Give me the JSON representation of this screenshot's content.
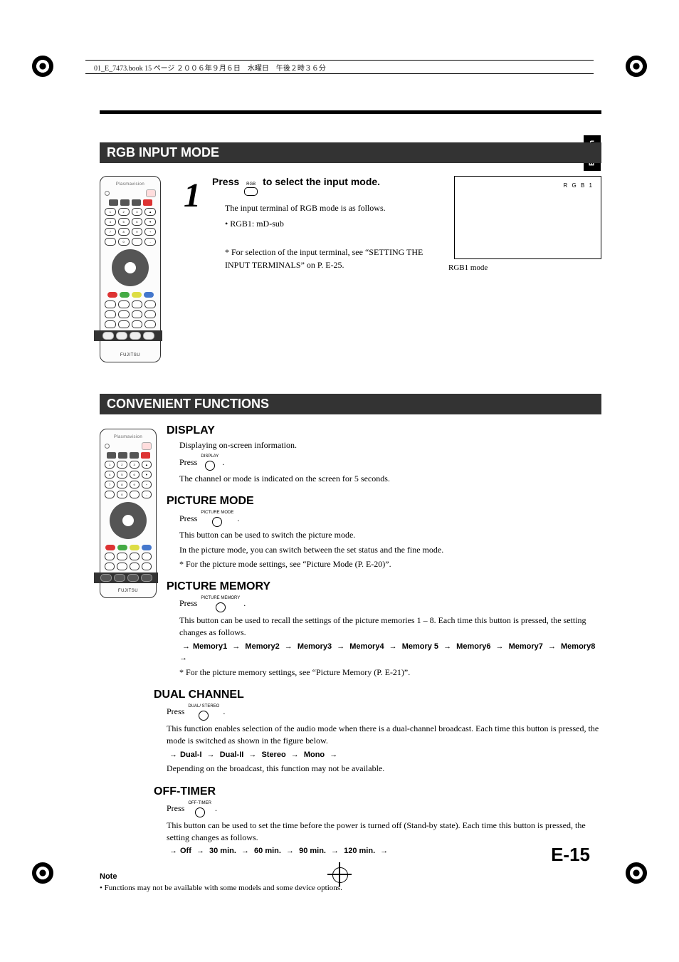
{
  "meta": {
    "running_header": "01_E_7473.book  15 ページ  ２００６年９月６日　水曜日　午後２時３６分",
    "side_tab": "English",
    "page_number": "E-15"
  },
  "section1": {
    "title": "RGB INPUT MODE",
    "step_number": "1",
    "step_head_prefix": "Press",
    "step_btn_label": "RGB",
    "step_head_suffix": "to select the input mode.",
    "p1": "The input terminal of RGB mode is as follows.",
    "bullet1": "• RGB1: mD-sub",
    "note_p1": "* For selection of the input terminal, see “SETTING THE INPUT TERMINALS” on P. E-25.",
    "osd_text": "R G B 1",
    "osd_caption": "RGB1 mode"
  },
  "section2": {
    "title": "CONVENIENT FUNCTIONS",
    "display": {
      "head": "DISPLAY",
      "p1": "Displaying on-screen information.",
      "press": "Press",
      "btn": "DISPLAY",
      "dot": ".",
      "p2": "The channel or mode is indicated on the screen for 5 seconds."
    },
    "picture_mode": {
      "head": "PICTURE MODE",
      "press": "Press",
      "btn": "PICTURE MODE",
      "dot": ".",
      "p1": "This button can be used to switch the picture mode.",
      "p2": "In the picture mode, you can switch between the set status and the fine mode.",
      "p3": "* For the picture mode settings, see “Picture Mode (P. E-20)”."
    },
    "picture_memory": {
      "head": "PICTURE MEMORY",
      "press": "Press",
      "btn": "PICTURE MEMORY",
      "dot": ".",
      "p1": "This button can be used to recall the settings of the picture memories 1 – 8. Each time this button is pressed, the setting changes as follows.",
      "seq_items": [
        "Memory1",
        "Memory2",
        "Memory3",
        "Memory4",
        "Memory 5",
        "Memory6",
        "Memory7",
        "Memory8"
      ],
      "p2": "* For the picture memory settings, see “Picture Memory (P. E-21)”."
    },
    "dual_channel": {
      "head": "DUAL CHANNEL",
      "press": "Press",
      "btn": "DUAL/ STEREO",
      "dot": ".",
      "p1": "This function enables selection of the audio mode when there is a dual-channel broadcast. Each time this button is pressed, the mode is switched as shown in the figure below.",
      "seq_items": [
        "Dual-I",
        "Dual-II",
        "Stereo",
        "Mono"
      ],
      "p2": "Depending on the broadcast, this function may not be available."
    },
    "off_timer": {
      "head": "OFF-TIMER",
      "press": "Press",
      "btn": "OFF-TIMER",
      "dot": ".",
      "p1": "This button can be used to set the time before the power is turned off (Stand-by state). Each time this button is pressed, the setting changes as follows.",
      "seq_items": [
        "Off",
        "30 min.",
        "60 min.",
        "90 min.",
        "120 min."
      ]
    },
    "footnote_head": "Note",
    "footnote_body": "• Functions may not be available with some models and some device options."
  },
  "remote": {
    "brand": "Plasmavision",
    "logo": "FUJITSU"
  }
}
